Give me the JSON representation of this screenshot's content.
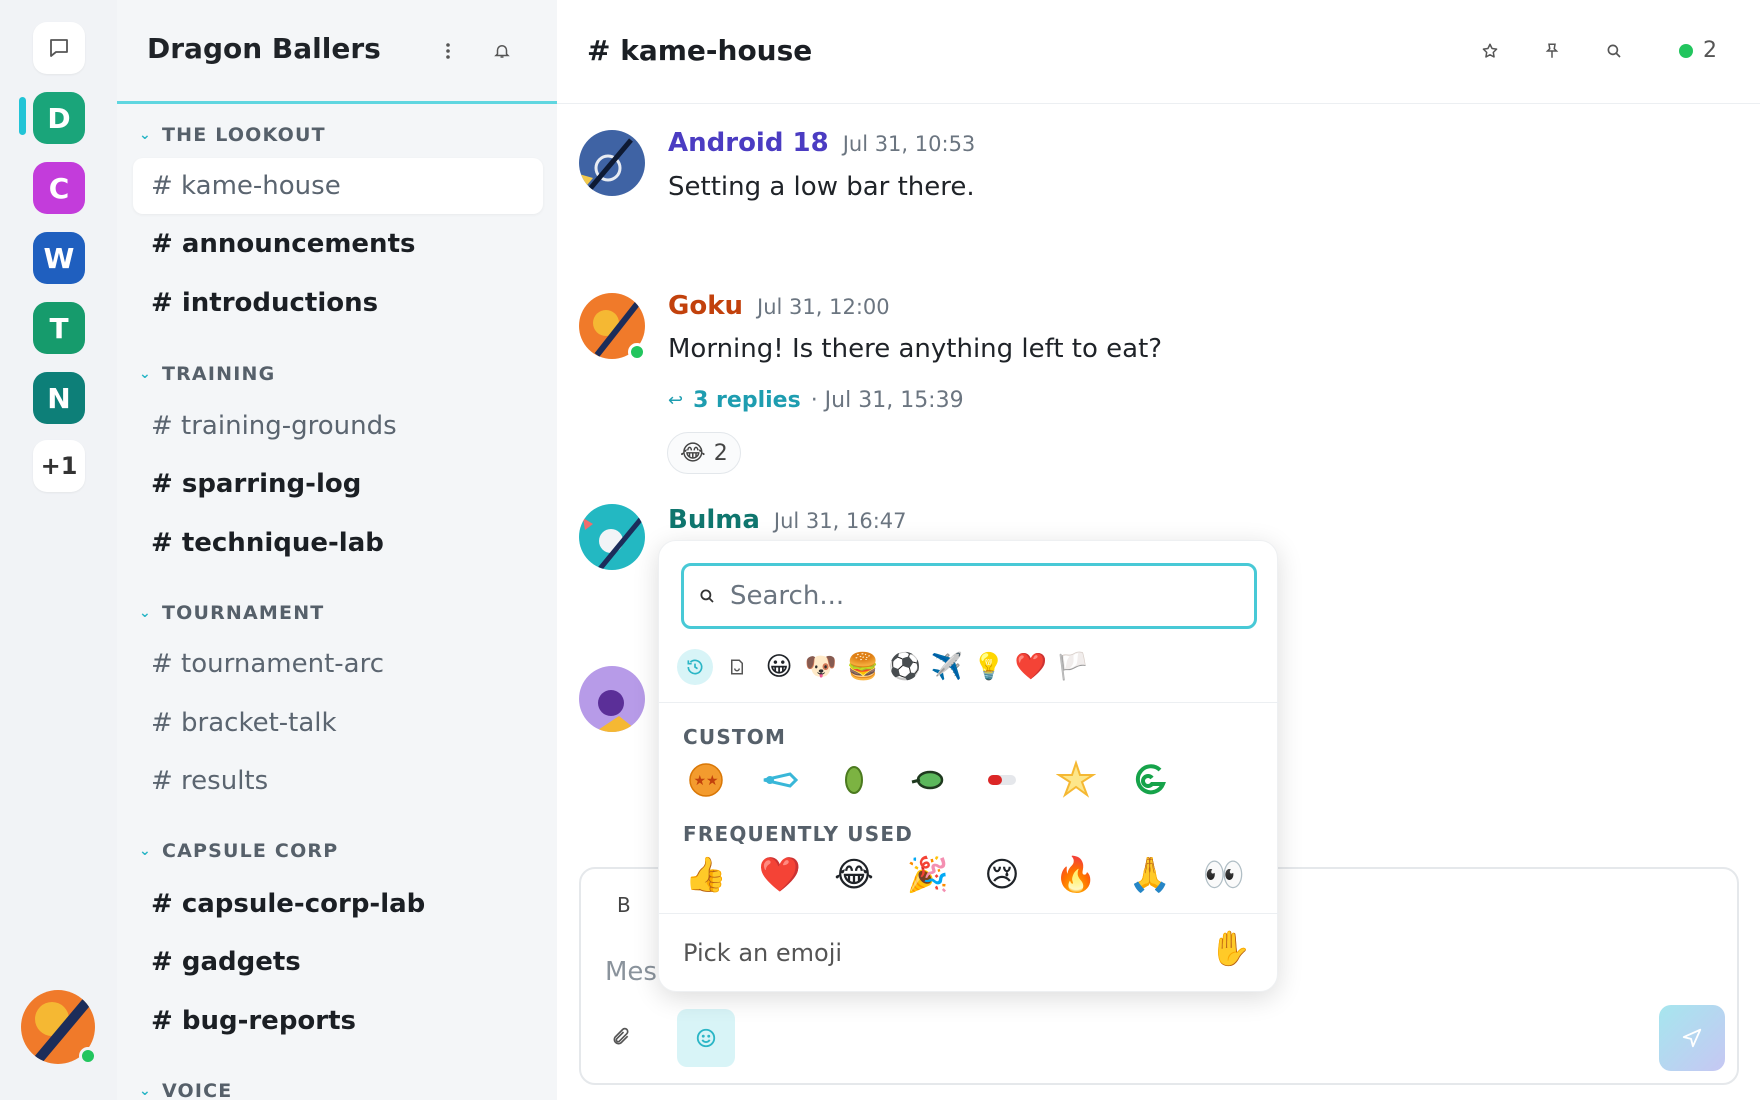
{
  "rail": {
    "home_icon": "chat-bubble-icon",
    "servers": [
      {
        "letter": "D",
        "color": "#1aa57a"
      },
      {
        "letter": "C",
        "color": "#c33cdb"
      },
      {
        "letter": "W",
        "color": "#1f5fbf"
      },
      {
        "letter": "T",
        "color": "#169b6c"
      },
      {
        "letter": "N",
        "color": "#0d7f78"
      }
    ],
    "more_label": "+1"
  },
  "sidebar": {
    "workspace_name": "Dragon Ballers",
    "sections": [
      {
        "label": "THE LOOKOUT",
        "channels": [
          "# kame-house",
          "# announcements",
          "# introductions"
        ]
      },
      {
        "label": "TRAINING",
        "channels": [
          "# training-grounds",
          "# sparring-log",
          "# technique-lab"
        ]
      },
      {
        "label": "TOURNAMENT",
        "channels": [
          "# tournament-arc",
          "# bracket-talk",
          "# results"
        ]
      },
      {
        "label": "CAPSULE CORP",
        "channels": [
          "# capsule-corp-lab",
          "# gadgets",
          "# bug-reports"
        ]
      },
      {
        "label": "VOICE",
        "channels": []
      }
    ]
  },
  "header": {
    "channel_title": "# kame-house",
    "online_count": "2"
  },
  "messages": [
    {
      "author": "Android 18",
      "color": "#4b3cc2",
      "time": "Jul 31, 10:53",
      "text": "Setting a low bar there."
    },
    {
      "author": "Goku",
      "color": "#c2410c",
      "time": "Jul 31, 12:00",
      "text": "Morning! Is there anything left to eat?",
      "thread": {
        "replies": "3 replies",
        "meta": "· Jul 31, 15:39"
      },
      "reaction": {
        "emoji": "😂",
        "count": "2"
      }
    },
    {
      "author": "Bulma",
      "color": "#0f766e",
      "time": "Jul 31, 16:47",
      "text": ""
    }
  ],
  "composer": {
    "bold_label": "B",
    "placeholder": "Mes"
  },
  "emoji_picker": {
    "search_placeholder": "Search...",
    "categories": [
      "😀",
      "🐶",
      "🍔",
      "⚽",
      "✈️",
      "💡",
      "❤️",
      "🏳️"
    ],
    "custom_label": "CUSTOM",
    "frequently_used_label": "FREQUENTLY USED",
    "frequently_used": [
      "👍",
      "❤️",
      "😂",
      "🎉",
      "😢",
      "🔥",
      "🙏",
      "👀"
    ],
    "footer_text": "Pick an emoji",
    "footer_emoji": "✋"
  }
}
